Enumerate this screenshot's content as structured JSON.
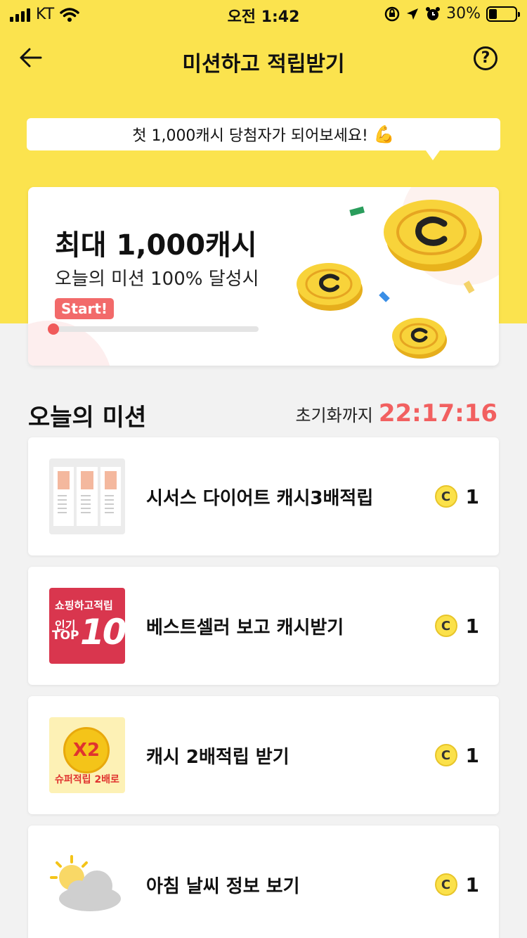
{
  "status_bar": {
    "carrier": "KT",
    "time": "오전 1:42",
    "battery": "30%",
    "battery_level": 0.3
  },
  "nav": {
    "title": "미션하고 적립받기",
    "help": "?"
  },
  "bubble": {
    "text": "첫 1,000캐시 당첨자가 되어보세요!",
    "emoji": "💪"
  },
  "reward_card": {
    "title": "최대 1,000캐시",
    "subtitle": "오늘의 미션 100% 달성시",
    "badge": "Start!",
    "progress": 0.0
  },
  "missions_section": {
    "title": "오늘의 미션",
    "reset_label": "초기화까지",
    "reset_time": "22:17:16"
  },
  "missions": [
    {
      "label": "시서스 다이어트 캐시3배적립",
      "coin": "C",
      "reward": "1"
    },
    {
      "label": "베스트셀러 보고 캐시받기",
      "coin": "C",
      "reward": "1",
      "thumb_text": [
        "쇼핑하고적립",
        "인기",
        "TOP",
        "10"
      ]
    },
    {
      "label": "캐시 2배적립 받기",
      "coin": "C",
      "reward": "1",
      "thumb_text": [
        "X2",
        "슈퍼적립 2배로"
      ]
    },
    {
      "label": "아침 날씨 정보 보기",
      "coin": "C",
      "reward": "1"
    }
  ],
  "colors": {
    "brand_yellow": "#fbe34e",
    "accent_red": "#f26a6a",
    "timer_red": "#f26060"
  },
  "icons": [
    "back-arrow-icon",
    "help-icon",
    "wifi-icon",
    "signal-icon",
    "battery-icon",
    "coin-icon",
    "sun-cloud-icon"
  ]
}
